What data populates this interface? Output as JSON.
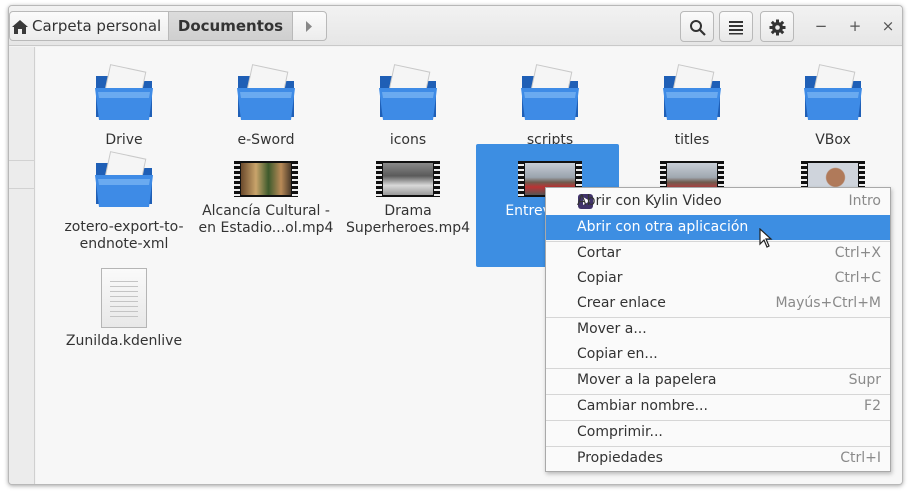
{
  "breadcrumb": {
    "home": "Carpeta personal",
    "current": "Documentos"
  },
  "toolbar": {
    "search_icon": "search-icon",
    "view_icon": "list-view-icon",
    "settings_icon": "gear-icon"
  },
  "window_controls": {
    "minimize": "−",
    "maximize": "+",
    "close": "×"
  },
  "files": [
    {
      "name": "Drive",
      "type": "folder"
    },
    {
      "name": "e-Sword",
      "type": "folder"
    },
    {
      "name": "icons",
      "type": "folder"
    },
    {
      "name": "scripts",
      "type": "folder"
    },
    {
      "name": "titles",
      "type": "folder"
    },
    {
      "name": "VBox",
      "type": "folder"
    },
    {
      "name": "zotero-export-to-endnote-xml",
      "type": "folder"
    },
    {
      "name": "Alcancía Cultural - en Estadio...ol.mp4",
      "type": "video"
    },
    {
      "name": "Drama Superheroes.mp4",
      "type": "video"
    },
    {
      "name": "Entrev agua.",
      "type": "video",
      "selected": true
    },
    {
      "name": "",
      "type": "video"
    },
    {
      "name": "",
      "type": "video"
    },
    {
      "name": "Zunilda.kdenlive",
      "type": "document"
    }
  ],
  "context_menu": {
    "items": [
      {
        "label": "Abrir con Kylin Video",
        "shortcut": "Intro"
      },
      {
        "label": "Abrir con otra aplicación",
        "shortcut": ""
      },
      {
        "label": "Cortar",
        "shortcut": "Ctrl+X"
      },
      {
        "label": "Copiar",
        "shortcut": "Ctrl+C"
      },
      {
        "label": "Crear enlace",
        "shortcut": "Mayús+Ctrl+M"
      },
      {
        "label": "Mover a...",
        "shortcut": ""
      },
      {
        "label": "Copiar en...",
        "shortcut": ""
      },
      {
        "label": "Mover a la papelera",
        "shortcut": "Supr"
      },
      {
        "label": "Cambiar nombre...",
        "shortcut": "F2"
      },
      {
        "label": "Comprimir...",
        "shortcut": ""
      },
      {
        "label": "Propiedades",
        "shortcut": "Ctrl+I"
      }
    ]
  },
  "colors": {
    "selection": "#3d8ee2",
    "folder": "#2f7fd8"
  }
}
